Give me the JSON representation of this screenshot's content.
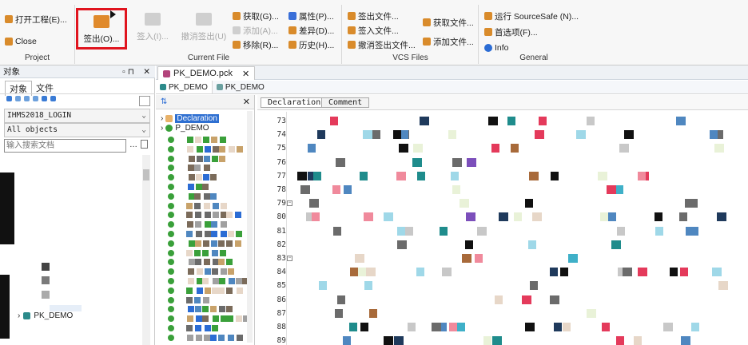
{
  "ribbon": {
    "project": {
      "title": "Project",
      "open_project": "打开工程(E)...",
      "close": "Close"
    },
    "current_file": {
      "title": "Current File",
      "checkout": "签出(O)...",
      "checkin": "签入(I)...",
      "undo_checkout": "撤消签出(U)",
      "get": "获取(G)...",
      "add": "添加(A)...",
      "move": "移除(R)...",
      "properties": "属性(P)...",
      "diff": "差异(D)...",
      "history": "历史(H)..."
    },
    "vcs_files": {
      "title": "VCS Files",
      "checkout_files": "签出文件...",
      "checkin_files": "签入文件...",
      "undo_checkout_files": "撤消签出文件...",
      "get_files": "获取文件...",
      "add_files": "添加文件..."
    },
    "general": {
      "title": "General",
      "run_sourcesafe": "运行 SourceSafe (N)...",
      "options": "首选项(F)...",
      "info": "Info"
    }
  },
  "object_panel": {
    "title": "对象",
    "tabs": [
      "对象",
      "文件"
    ],
    "connection": "IHMS2018_LOGIN",
    "filter": "All objects",
    "search_placeholder": "输入搜索文档",
    "tree_item": "PK_DEMO"
  },
  "editor": {
    "file_tab": "PK_DEMO.pck",
    "sub_tabs": [
      "PK_DEMO",
      "PK_DEMO"
    ],
    "nav_tree": {
      "items": [
        "Declaration",
        "P_DEMO"
      ]
    },
    "view_tabs": [
      "Declaration",
      "Comment"
    ],
    "line_numbers": [
      "73",
      "74",
      "75",
      "76",
      "77",
      "78",
      "79",
      "80",
      "81",
      "82",
      "83",
      "84",
      "85",
      "86",
      "87",
      "88",
      "89"
    ]
  }
}
